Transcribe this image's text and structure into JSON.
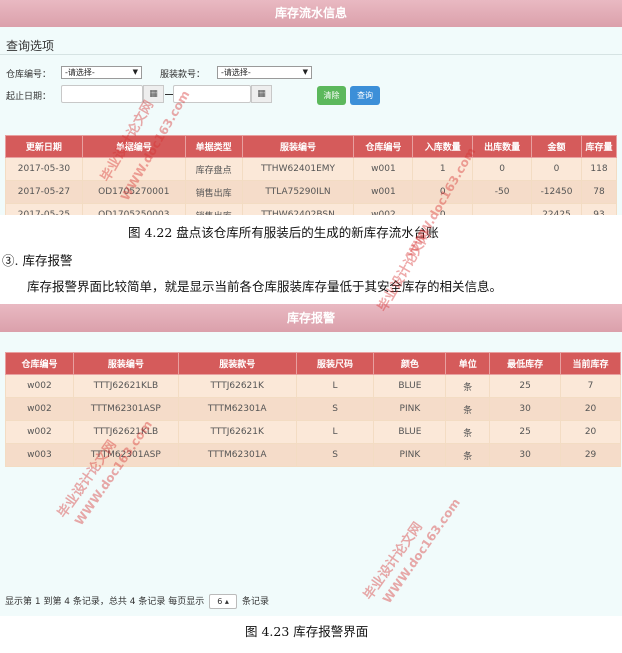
{
  "inventory_flow": {
    "title": "库存流水信息",
    "query_section_title": "查询选项",
    "warehouse_label": "仓库编号：",
    "warehouse_select": "-请选择-",
    "style_label": "服装款号：",
    "style_select": "-请选择-",
    "date_label": "起止日期：",
    "calendar_icon": "calendar-icon",
    "clear_button": "清除",
    "query_button": "查询",
    "columns": [
      "更新日期",
      "单据编号",
      "单据类型",
      "服装编号",
      "仓库编号",
      "入库数量",
      "出库数量",
      "金额",
      "库存量"
    ],
    "rows": [
      [
        "2017-05-30",
        "",
        "库存盘点",
        "TTHW62401EMY",
        "w001",
        "1",
        "0",
        "0",
        "118"
      ],
      [
        "2017-05-27",
        "OD1705270001",
        "销售出库",
        "TTLA75290ILN",
        "w001",
        "0",
        "-50",
        "-12450",
        "78"
      ],
      [
        "2017-05-25",
        "OD1705250003",
        "销售出库",
        "TTHW62402BSN",
        "w002",
        "0",
        "",
        "22425",
        "93"
      ]
    ]
  },
  "caption_1": "图 4.22  盘点该仓库所有服装后的生成的新库存流水台账",
  "section_heading": "③. 库存报警",
  "paragraph": "库存报警界面比较简单，就是显示当前各仓库服装库存量低于其安全库存的相关信息。",
  "stock_alert": {
    "title": "库存报警",
    "columns": [
      "仓库编号",
      "服装编号",
      "服装款号",
      "服装尺码",
      "颜色",
      "单位",
      "最低库存",
      "当前库存"
    ],
    "rows": [
      [
        "w002",
        "TTTJ62621KLB",
        "TTTJ62621K",
        "L",
        "BLUE",
        "条",
        "25",
        "7"
      ],
      [
        "w002",
        "TTTM62301ASP",
        "TTTM62301A",
        "S",
        "PINK",
        "条",
        "30",
        "20"
      ],
      [
        "w002",
        "TTTJ62621KLB",
        "TTTJ62621K",
        "L",
        "BLUE",
        "条",
        "25",
        "20"
      ],
      [
        "w003",
        "TTTM62301ASP",
        "TTTM62301A",
        "S",
        "PINK",
        "条",
        "30",
        "29"
      ]
    ],
    "pager_text": "显示第 1 到第 4 条记录，总共 4 条记录 每页显示",
    "page_size": "6",
    "pager_suffix": "条记录"
  },
  "caption_2": "图 4.23  库存报警界面",
  "watermark_cn": "毕业设计论文网",
  "watermark_url": "WWW.doc163.com"
}
